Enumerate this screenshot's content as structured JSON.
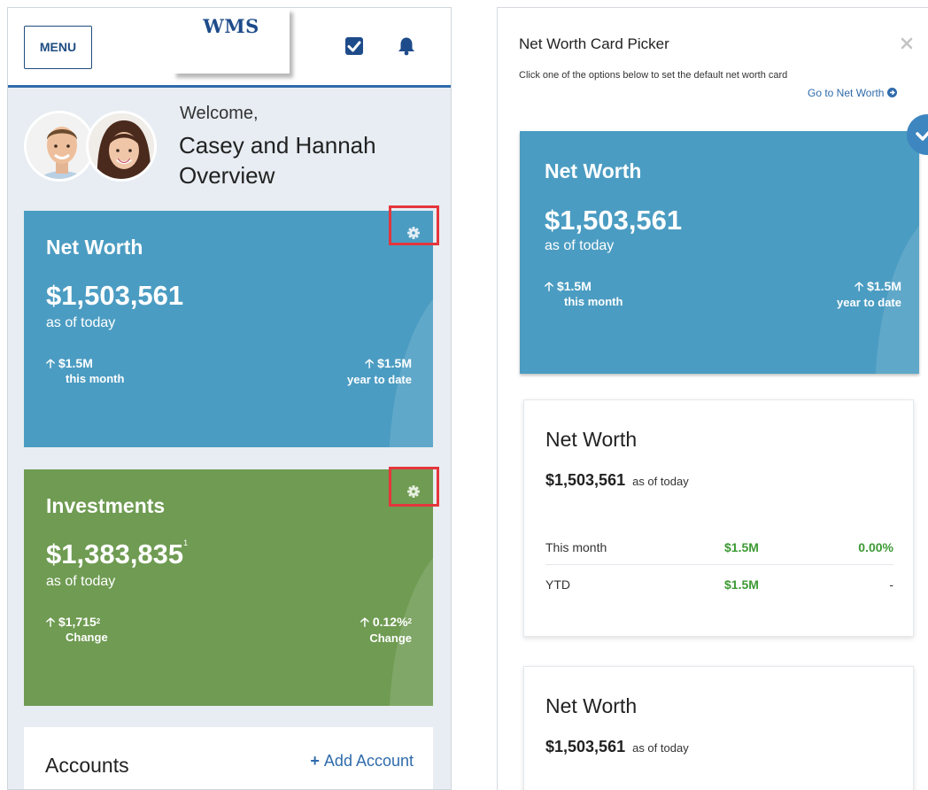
{
  "left": {
    "header": {
      "menu_label": "MENU",
      "logo_text": "WMS",
      "tasks_icon": "checkbox-icon",
      "notifications_icon": "bell-icon"
    },
    "welcome": {
      "greeting": "Welcome,",
      "name_line1": "Casey and Hannah",
      "name_line2": "Overview"
    },
    "net_worth_card": {
      "title": "Net Worth",
      "value": "$1,503,561",
      "sub": "as of today",
      "stat_left_value": "$1.5M",
      "stat_left_label": "this month",
      "stat_right_value": "$1.5M",
      "stat_right_label": "year to date",
      "color": "#4b9cc2"
    },
    "investments_card": {
      "title": "Investments",
      "value": "$1,383,835",
      "value_footnote": "1",
      "sub": "as of today",
      "stat_left_value": "$1,715",
      "stat_left_footnote": "2",
      "stat_left_label": "Change",
      "stat_right_value": "0.12%",
      "stat_right_footnote": "2",
      "stat_right_label": "Change",
      "color": "#6f9b52"
    },
    "accounts": {
      "title": "Accounts",
      "add_label": "Add Account"
    },
    "highlight_color": "#e4363c"
  },
  "picker": {
    "title": "Net Worth Card Picker",
    "description": "Click one of the options below to set the default net worth card",
    "link_label": "Go to Net Worth",
    "selected_card": {
      "title": "Net Worth",
      "value": "$1,503,561",
      "sub": "as of today",
      "stat_left_value": "$1.5M",
      "stat_left_label": "this month",
      "stat_right_value": "$1.5M",
      "stat_right_label": "year to date"
    },
    "table_card": {
      "title": "Net Worth",
      "value": "$1,503,561",
      "as_of": "as of today",
      "rows": [
        {
          "label": "This month",
          "amount": "$1.5M",
          "percent": "0.00%"
        },
        {
          "label": "YTD",
          "amount": "$1.5M",
          "percent": "-"
        }
      ]
    },
    "compact_card": {
      "title": "Net Worth",
      "value": "$1,503,561",
      "as_of": "as of today"
    },
    "accent_color": "#2f6bab",
    "positive_color": "#3d9a34"
  }
}
